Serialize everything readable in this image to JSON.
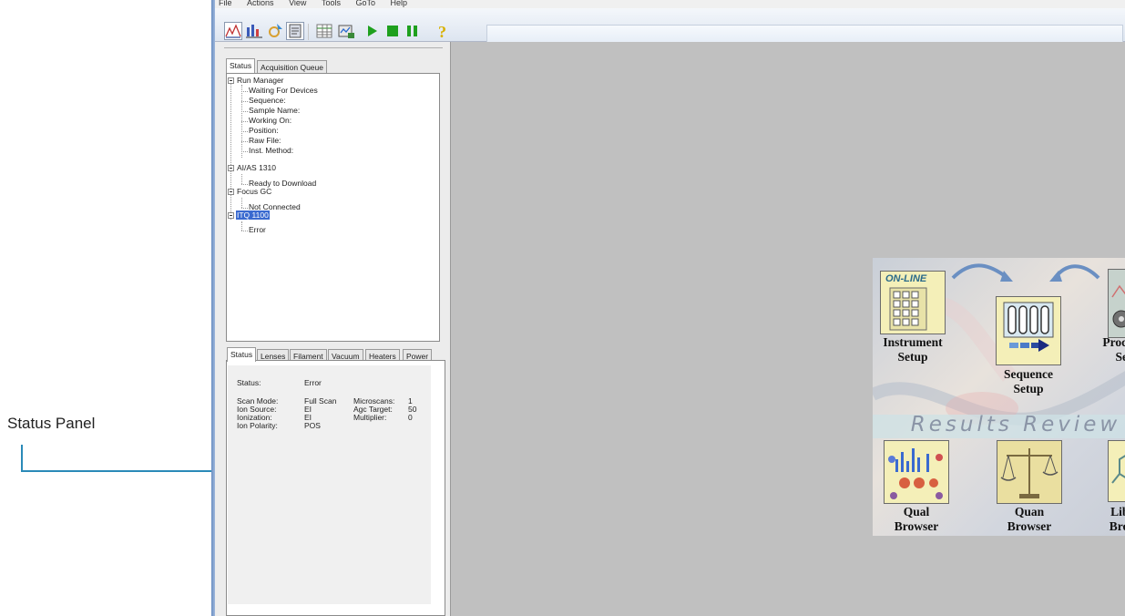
{
  "callout": {
    "label": "Status Panel"
  },
  "menubar": {
    "items": [
      "File",
      "Actions",
      "View",
      "Tools",
      "GoTo",
      "Help"
    ]
  },
  "toolbar": {
    "buttons": [
      "instrument-setup-icon",
      "sequence-icon",
      "tune-icon",
      "status-icon",
      "grid-icon",
      "acquisition-icon",
      "start-icon",
      "stop-icon",
      "pause-icon",
      "help-icon"
    ],
    "colors": {
      "play": "#1ea01e",
      "stop": "#1ea01e",
      "pause": "#1ea01e",
      "help": "#d8b000"
    }
  },
  "top_tabs": {
    "status": "Status",
    "queue": "Acquisition Queue"
  },
  "tree": {
    "run_manager": {
      "label": "Run Manager",
      "children": [
        "Waiting For Devices",
        "Sequence:",
        "Sample Name:",
        "Working On:",
        "Position:",
        "Raw File:",
        "Inst. Method:"
      ]
    },
    "autosampler": {
      "label": "AI/AS 1310",
      "children": [
        "Ready to Download"
      ]
    },
    "gc": {
      "label": "Focus GC",
      "children": [
        "Not Connected"
      ]
    },
    "ms": {
      "label": "ITQ 1100",
      "children": [
        "Error"
      ]
    }
  },
  "bottom_tabs": [
    "Status",
    "Lenses",
    "Filament",
    "Vacuum",
    "Heaters",
    "Power"
  ],
  "status_panel": {
    "status_label": "Status:",
    "status_value": "Error",
    "left_labels": [
      "Scan Mode:",
      "Ion Source:",
      "Ionization:",
      "Ion Polarity:"
    ],
    "left_values": [
      "Full Scan",
      "EI",
      "EI",
      "POS"
    ],
    "right_labels": [
      "Microscans:",
      "Agc Target:",
      "Multiplier:"
    ],
    "right_values": [
      "1",
      "50",
      "0"
    ]
  },
  "splash": {
    "online": "ON-LINE",
    "instrument": [
      "Instrument",
      "Setup"
    ],
    "sequence": [
      "Sequence",
      "Setup"
    ],
    "processing": [
      "Processing",
      "Setup"
    ],
    "results": "Results Review",
    "qual": [
      "Qual",
      "Browser"
    ],
    "quan": [
      "Quan",
      "Browser"
    ],
    "library": [
      "Library",
      "Browser"
    ]
  }
}
